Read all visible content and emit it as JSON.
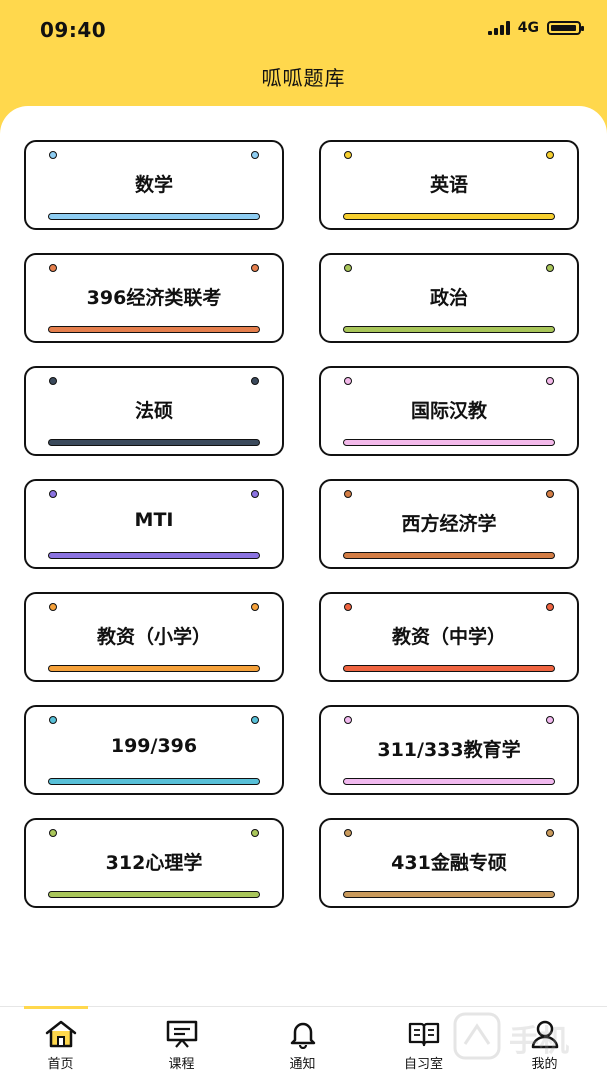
{
  "status_bar": {
    "time": "09:40",
    "network": "4G"
  },
  "header": {
    "title": "呱呱题库"
  },
  "subjects": [
    {
      "label": "数学",
      "color": "#8ecdf2"
    },
    {
      "label": "英语",
      "color": "#f6cf2f"
    },
    {
      "label": "396经济类联考",
      "color": "#e57f4d"
    },
    {
      "label": "政治",
      "color": "#a9c65a"
    },
    {
      "label": "法硕",
      "color": "#3b4a5c"
    },
    {
      "label": "国际汉教",
      "color": "#f3b9ea"
    },
    {
      "label": "MTI",
      "color": "#8b73e0"
    },
    {
      "label": "西方经济学",
      "color": "#d37d45"
    },
    {
      "label": "教资（小学）",
      "color": "#f5a13a"
    },
    {
      "label": "教资（中学）",
      "color": "#ef6440"
    },
    {
      "label": "199/396",
      "color": "#58c0d8"
    },
    {
      "label": "311/333教育学",
      "color": "#f1b9ef"
    },
    {
      "label": "312心理学",
      "color": "#a9c65a"
    },
    {
      "label": "431金融专硕",
      "color": "#c99a5c"
    }
  ],
  "tabbar": {
    "tabs": [
      {
        "label": "首页",
        "icon": "home-icon",
        "active": true
      },
      {
        "label": "课程",
        "icon": "presentation-board-icon",
        "active": false
      },
      {
        "label": "通知",
        "icon": "bell-icon",
        "active": false
      },
      {
        "label": "自习室",
        "icon": "open-book-icon",
        "active": false
      },
      {
        "label": "我的",
        "icon": "user-icon",
        "active": false
      }
    ]
  },
  "colors": {
    "header_bg": "#ffd84d",
    "accent": "#ffd84d"
  }
}
